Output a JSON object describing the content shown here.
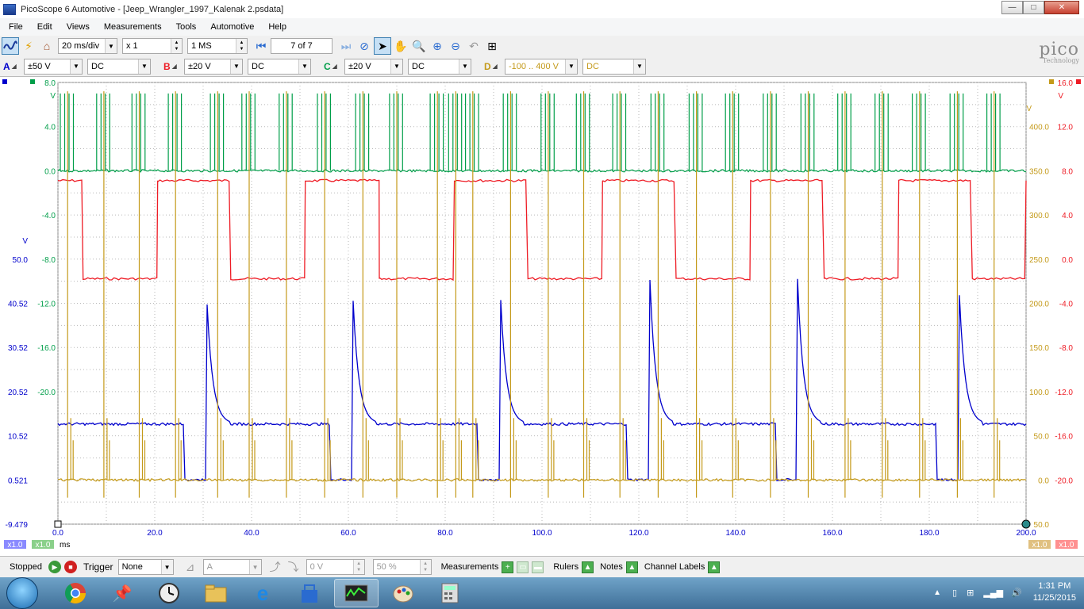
{
  "window": {
    "title": "PicoScope 6 Automotive - [Jeep_Wrangler_1997_Kalenak 2.psdata]",
    "min_glyph": "—",
    "max_glyph": "□",
    "close_glyph": "✕"
  },
  "menu": [
    "File",
    "Edit",
    "Views",
    "Measurements",
    "Tools",
    "Automotive",
    "Help"
  ],
  "toolbar": {
    "timebase": "20 ms/div",
    "zoom": "x 1",
    "samples": "1 MS",
    "buffer": "7 of 7"
  },
  "channels": [
    {
      "letter": "A",
      "range": "±50 V",
      "coupling": "DC",
      "color": "#0000cc"
    },
    {
      "letter": "B",
      "range": "±20 V",
      "coupling": "DC",
      "color": "#ee1c25"
    },
    {
      "letter": "C",
      "range": "±20 V",
      "coupling": "DC",
      "color": "#009e49"
    },
    {
      "letter": "D",
      "range": "-100 .. 400 V",
      "coupling": "DC",
      "color": "#c49a1a"
    }
  ],
  "logo": {
    "name": "pico",
    "tagline": "Technology"
  },
  "axes": {
    "x_unit": "ms",
    "x_ticks": [
      "0.0",
      "20.0",
      "40.0",
      "60.0",
      "80.0",
      "100.0",
      "120.0",
      "140.0",
      "160.0",
      "180.0",
      "200.0"
    ],
    "green_unit": "V",
    "green_ticks": [
      "8.0",
      "4.0",
      "0.0",
      "-4.0",
      "-8.0",
      "-12.0",
      "-16.0",
      "-20.0"
    ],
    "blue_unit": "V",
    "blue_ticks": [
      "50.0",
      "40.52",
      "30.52",
      "20.52",
      "10.52",
      "0.521",
      "-9.479"
    ],
    "gold_unit": "V",
    "gold_ticks": [
      "400.0",
      "350.0",
      "300.0",
      "250.0",
      "200.0",
      "150.0",
      "100.0",
      "50.0",
      "0.0",
      "50.0"
    ],
    "red_unit": "V",
    "red_ticks": [
      "16.0",
      "12.0",
      "8.0",
      "4.0",
      "0.0",
      "-4.0",
      "-8.0",
      "-12.0",
      "-16.0",
      "-20.0"
    ],
    "scale_badge": "x1.0"
  },
  "status": {
    "state": "Stopped",
    "trigger_label": "Trigger",
    "trigger_mode": "None",
    "trigger_source": "A",
    "trigger_level": "0 V",
    "trigger_percent": "50 %",
    "measurements": "Measurements",
    "rulers": "Rulers",
    "notes": "Notes",
    "channel_labels": "Channel Labels"
  },
  "taskbar": {
    "time": "1:31 PM",
    "date": "11/25/2015",
    "apps": [
      "chrome-icon",
      "pin-icon",
      "clock-icon",
      "folder-icon",
      "ie-icon",
      "store-icon",
      "picoscope-icon",
      "paint-icon",
      "calculator-icon"
    ]
  },
  "chart_data": {
    "type": "line",
    "title": "",
    "x_range": [
      0,
      200
    ],
    "grid": true,
    "series": [
      {
        "name": "A",
        "color": "#0000cc",
        "unit_range": [
          -9.479,
          50.0
        ],
        "baseline": 13.0,
        "low_level": 0.5,
        "spike_level": 48.0,
        "spike_times_ms": [
          30.5,
          60.7,
          91.2,
          122.2,
          152.7,
          186.0
        ]
      },
      {
        "name": "B",
        "color": "#ee1c25",
        "unit_range": [
          -20,
          16
        ],
        "high_level": 8.0,
        "low_level": 0.0,
        "transitions_ms": [
          0,
          5.2,
          20.6,
          35.7,
          51.1,
          66.4,
          81.9,
          97.1,
          112.5,
          127.7,
          143.1,
          158.3,
          173.7,
          188.9,
          200
        ]
      },
      {
        "name": "C",
        "color": "#009e49",
        "unit_range": [
          -4,
          8
        ],
        "baseline": 0.0,
        "pulse_level": 7.0
      },
      {
        "name": "D",
        "color": "#c49a1a",
        "unit_range": [
          -100,
          400
        ],
        "baseline": 0.0,
        "spike_level": 440,
        "spike_times_ms": [
          2.0,
          9.5,
          16.8,
          24.3,
          33.0,
          39.5,
          47.2,
          55.1,
          63.0,
          70.0,
          78.4,
          82.2,
          85.7,
          93.5,
          101.3,
          108.6,
          116.1,
          124.0,
          131.9,
          139.4,
          147.2,
          155.0,
          162.6,
          170.3,
          178.0,
          185.8,
          193.4
        ]
      }
    ]
  }
}
